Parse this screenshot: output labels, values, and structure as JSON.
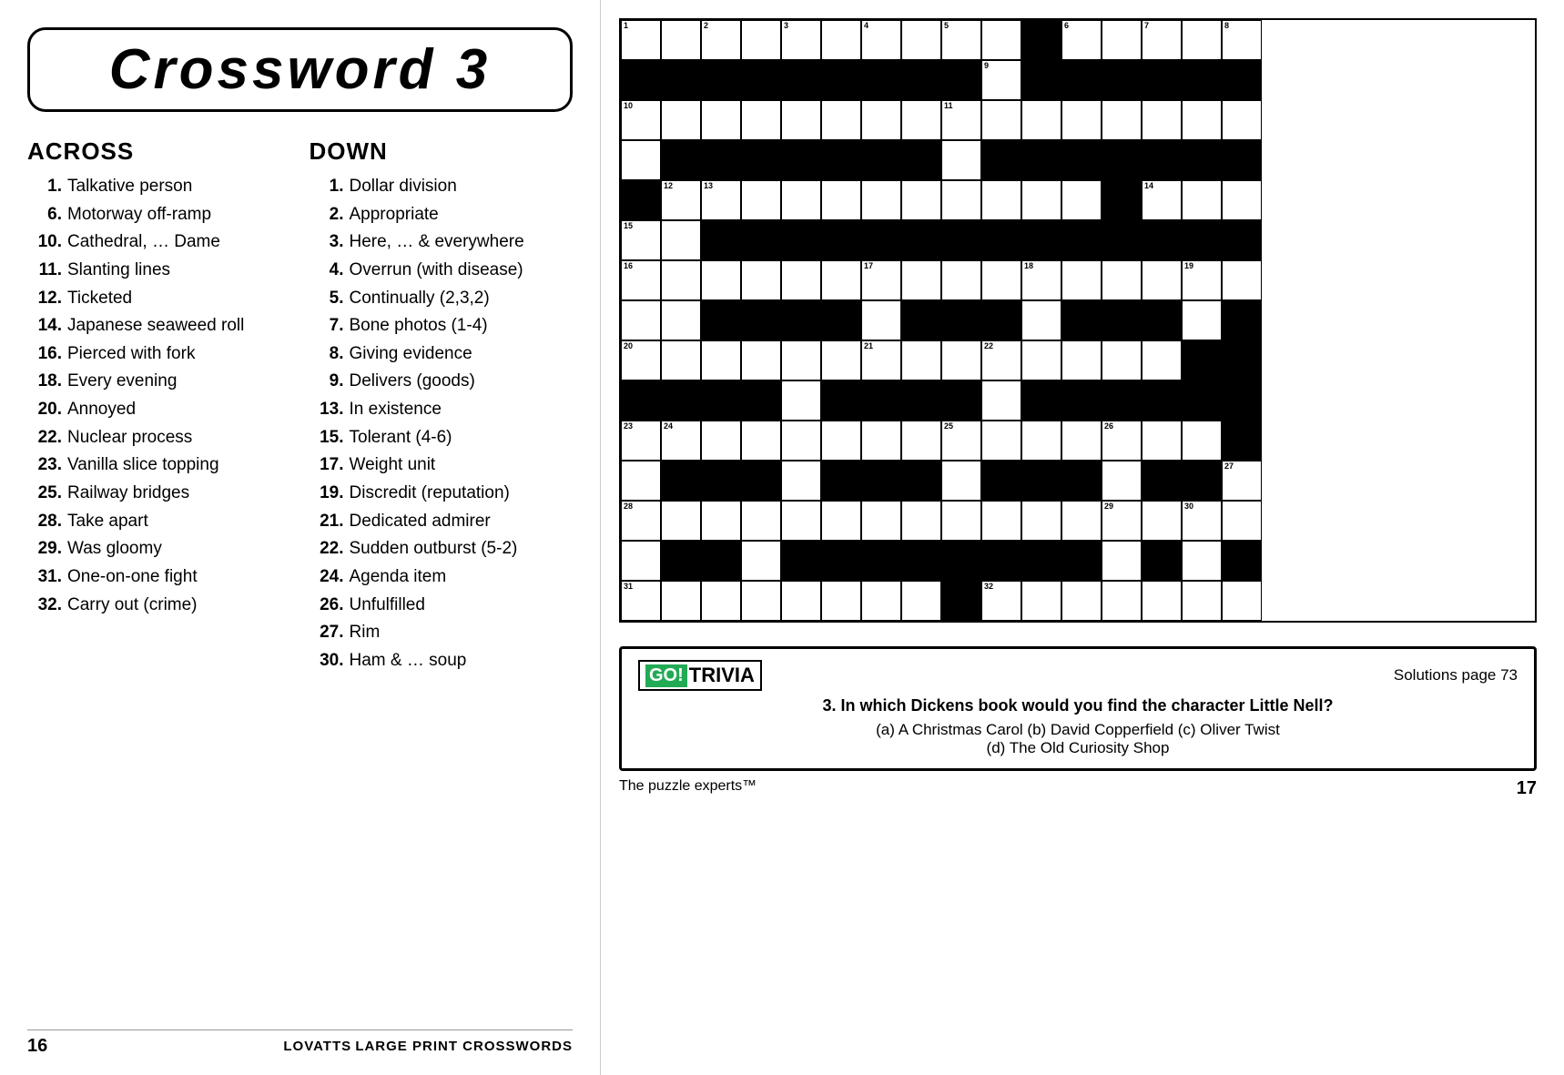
{
  "title": "Crossword   3",
  "across": {
    "heading": "ACROSS",
    "clues": [
      {
        "num": "1.",
        "text": "Talkative person"
      },
      {
        "num": "6.",
        "text": "Motorway off-ramp"
      },
      {
        "num": "10.",
        "text": "Cathedral, … Dame"
      },
      {
        "num": "11.",
        "text": "Slanting lines"
      },
      {
        "num": "12.",
        "text": "Ticketed"
      },
      {
        "num": "14.",
        "text": "Japanese seaweed roll"
      },
      {
        "num": "16.",
        "text": "Pierced with fork"
      },
      {
        "num": "18.",
        "text": "Every evening"
      },
      {
        "num": "20.",
        "text": "Annoyed"
      },
      {
        "num": "22.",
        "text": "Nuclear process"
      },
      {
        "num": "23.",
        "text": "Vanilla slice topping"
      },
      {
        "num": "25.",
        "text": "Railway bridges"
      },
      {
        "num": "28.",
        "text": "Take apart"
      },
      {
        "num": "29.",
        "text": "Was gloomy"
      },
      {
        "num": "31.",
        "text": "One-on-one fight"
      },
      {
        "num": "32.",
        "text": "Carry out (crime)"
      }
    ]
  },
  "down": {
    "heading": "DOWN",
    "clues": [
      {
        "num": "1.",
        "text": "Dollar division"
      },
      {
        "num": "2.",
        "text": "Appropriate"
      },
      {
        "num": "3.",
        "text": "Here, … & everywhere"
      },
      {
        "num": "4.",
        "text": "Overrun (with disease)"
      },
      {
        "num": "5.",
        "text": "Continually (2,3,2)"
      },
      {
        "num": "7.",
        "text": "Bone photos (1-4)"
      },
      {
        "num": "8.",
        "text": "Giving evidence"
      },
      {
        "num": "9.",
        "text": "Delivers (goods)"
      },
      {
        "num": "13.",
        "text": "In existence"
      },
      {
        "num": "15.",
        "text": "Tolerant (4-6)"
      },
      {
        "num": "17.",
        "text": "Weight unit"
      },
      {
        "num": "19.",
        "text": "Discredit (reputation)"
      },
      {
        "num": "21.",
        "text": "Dedicated admirer"
      },
      {
        "num": "22.",
        "text": "Sudden outburst (5-2)"
      },
      {
        "num": "24.",
        "text": "Agenda item"
      },
      {
        "num": "26.",
        "text": "Unfulfilled"
      },
      {
        "num": "27.",
        "text": "Rim"
      },
      {
        "num": "30.",
        "text": "Ham & … soup"
      }
    ]
  },
  "footer": {
    "left_page_num": "16",
    "right_page_num": "17",
    "center_brand": "LOVATTS",
    "center_text": "LARGE PRINT CROSSWORDS",
    "right_tagline": "The puzzle experts™"
  },
  "trivia": {
    "logo_prefix": "GO!",
    "logo_main": "TRIVIA",
    "solutions": "Solutions page 73",
    "question": "3. In which Dickens book would you find the character Little Nell?",
    "answers": "(a) A Christmas Carol  (b) David Copperfield  (c) Oliver Twist\n(d) The Old Curiosity Shop"
  }
}
